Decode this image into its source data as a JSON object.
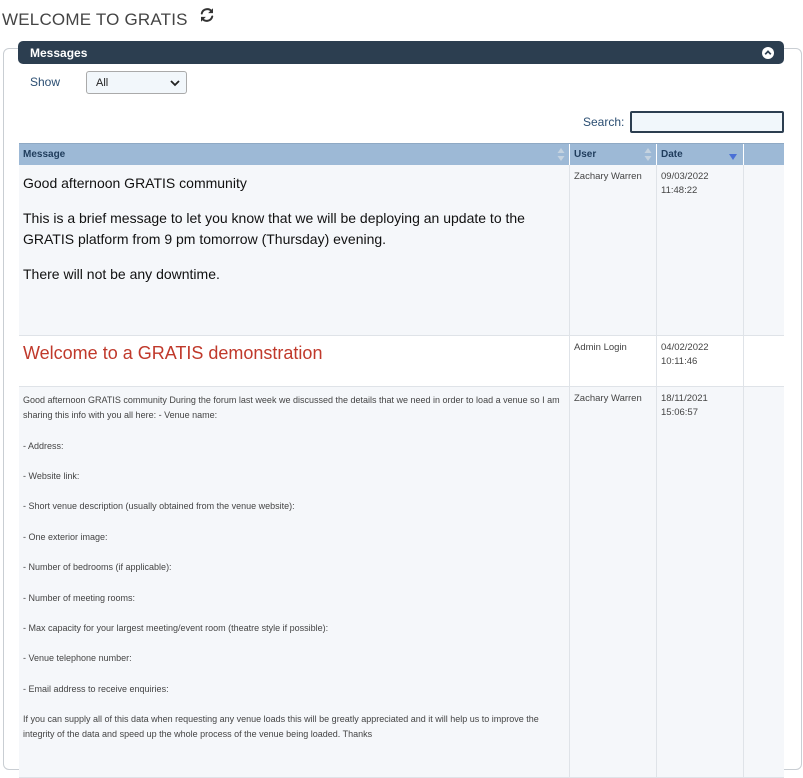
{
  "header": {
    "title": "WELCOME TO GRATIS"
  },
  "panel": {
    "title": "Messages"
  },
  "filter": {
    "show_label": "Show",
    "show_value": "All"
  },
  "search": {
    "label": "Search:",
    "value": ""
  },
  "table": {
    "columns": [
      "Message",
      "User",
      "Date"
    ],
    "rows": [
      {
        "paragraphs": [
          "Good afternoon GRATIS community",
          "This is a brief message to let you know that we will be deploying an update to the GRATIS platform from 9 pm tomorrow (Thursday) evening.",
          "There will not be any downtime."
        ],
        "user": "Zachary Warren",
        "date": "09/03/2022",
        "time": "11:48:22"
      },
      {
        "title": "Welcome to a GRATIS demonstration",
        "user": "Admin Login",
        "date": "04/02/2022",
        "time": "10:11:46"
      },
      {
        "paragraphs": [
          "Good afternoon GRATIS community During the forum last week we discussed the details that we need in order to load a venue so I am sharing this info with you all here:  - Venue name:",
          "- Address:",
          "- Website link:",
          "- Short venue description (usually obtained from the venue website):",
          "- One exterior image:",
          "- Number of bedrooms (if applicable):",
          "- Number of meeting rooms:",
          "- Max capacity for your largest meeting/event room (theatre style if possible):",
          "- Venue telephone number:",
          "- Email address to receive enquiries:",
          "If you can supply all of this data when requesting any venue loads this will be greatly appreciated and it will help us to improve the integrity of the data and speed up the whole process of the venue being loaded. Thanks"
        ],
        "user": "Zachary Warren",
        "date": "18/11/2021",
        "time": "15:06:57"
      }
    ]
  },
  "colors": {
    "panel_bar": "#2c3e50",
    "header_row": "#9db9d6",
    "title_red": "#c0392b",
    "link_blue": "#2b4e72"
  },
  "icons": {
    "refresh": "refresh-icon",
    "collapse": "chevron-up-circle-icon",
    "sort": "sort-icon",
    "dropdown": "chevron-down-icon"
  }
}
